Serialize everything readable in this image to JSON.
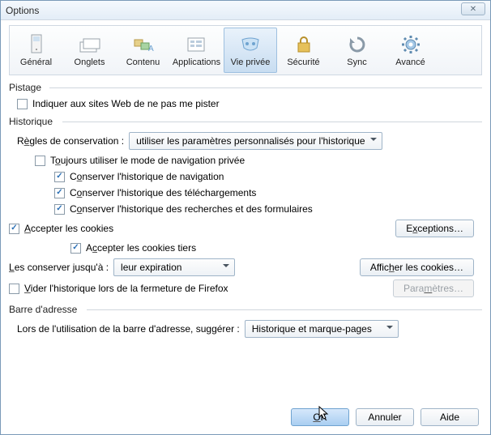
{
  "window": {
    "title": "Options"
  },
  "tabs": {
    "general": "Général",
    "onglets": "Onglets",
    "contenu": "Contenu",
    "applications": "Applications",
    "vieprivee": "Vie privée",
    "securite": "Sécurité",
    "sync": "Sync",
    "avance": "Avancé"
  },
  "pistage": {
    "legend": "Pistage",
    "dnt": "Indiquer aux sites Web de ne pas me pister"
  },
  "historique": {
    "legend": "Historique",
    "rules_label_pre": "R",
    "rules_label_key": "è",
    "rules_label_post": "gles de conservation :",
    "rules_value": "utiliser les paramètres personnalisés pour l'historique",
    "always_private_pre": "T",
    "always_private_key": "o",
    "always_private_post": "ujours utiliser le mode de navigation privée",
    "keep_nav_pre": "C",
    "keep_nav_key": "o",
    "keep_nav_post": "nserver l'historique de navigation",
    "keep_dl_pre": "C",
    "keep_dl_key": "o",
    "keep_dl_post": "nserver l'historique des téléchargements",
    "keep_search_pre": "C",
    "keep_search_key": "o",
    "keep_search_post": "nserver l'historique des recherches et des formulaires",
    "accept_cookies_key": "A",
    "accept_cookies_post": "ccepter les cookies",
    "exceptions_pre": "E",
    "exceptions_key": "x",
    "exceptions_post": "ceptions…",
    "accept_third_pre": "A",
    "accept_third_key": "c",
    "accept_third_post": "cepter les cookies tiers",
    "keep_until_pre": "",
    "keep_until_key": "L",
    "keep_until_post": "es conserver jusqu'à :",
    "keep_until_value": "leur expiration",
    "show_cookies_pre": "Affic",
    "show_cookies_key": "h",
    "show_cookies_post": "er les cookies…",
    "clear_on_close_pre": "",
    "clear_on_close_key": "V",
    "clear_on_close_post": "ider l'historique lors de la fermeture de Firefox",
    "params_pre": "Para",
    "params_key": "m",
    "params_post": "ètres…"
  },
  "addressbar": {
    "legend": "Barre d'adresse",
    "suggest_pre": "Lors de l'utilisation de la barre d'adresse, su",
    "suggest_key": "g",
    "suggest_post": "gérer :",
    "suggest_value": "Historique et marque-pages"
  },
  "footer": {
    "ok_key": "O",
    "ok_post": "K",
    "cancel": "Annuler",
    "help": "Aide"
  }
}
